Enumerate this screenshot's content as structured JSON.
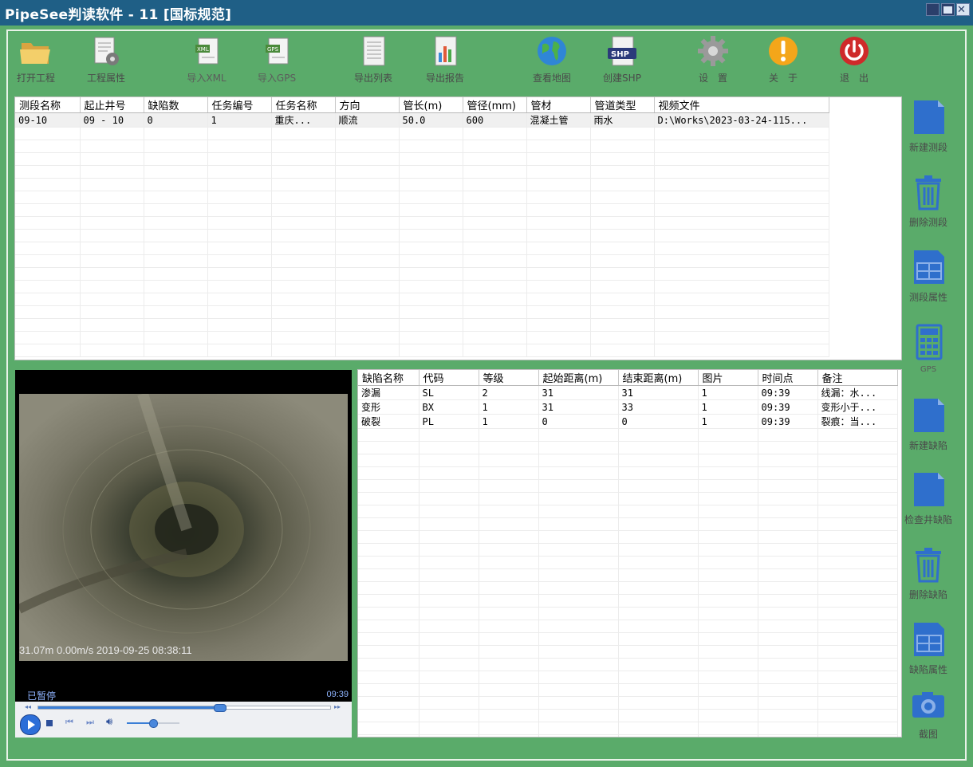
{
  "window": {
    "title": "PipeSee判读软件 - 11 [国标规范]"
  },
  "toolbar": [
    {
      "id": "open",
      "label": "打开工程",
      "icon": "folder-icon"
    },
    {
      "id": "props",
      "label": "工程属性",
      "icon": "project-settings-icon"
    },
    {
      "id": "xml",
      "label": "导入XML",
      "icon": "xml-file-icon"
    },
    {
      "id": "gps",
      "label": "导入GPS",
      "icon": "gps-file-icon"
    },
    {
      "id": "list",
      "label": "导出列表",
      "icon": "document-icon"
    },
    {
      "id": "report",
      "label": "导出报告",
      "icon": "report-chart-icon"
    },
    {
      "id": "map",
      "label": "查看地图",
      "icon": "globe-icon"
    },
    {
      "id": "shp",
      "label": "创建SHP",
      "icon": "shp-file-icon"
    },
    {
      "id": "settings",
      "label": "设　置",
      "icon": "gear-icon"
    },
    {
      "id": "about",
      "label": "关　于",
      "icon": "info-exclamation-icon"
    },
    {
      "id": "exit",
      "label": "退　出",
      "icon": "power-icon"
    }
  ],
  "segments_table": {
    "columns": [
      "测段名称",
      "起止井号",
      "缺陷数",
      "任务编号",
      "任务名称",
      "方向",
      "管长(m)",
      "管径(mm)",
      "管材",
      "管道类型",
      "视频文件"
    ],
    "rows": [
      [
        "09-10",
        "09 - 10",
        "0",
        "1",
        "重庆...",
        "顺流",
        "50.0",
        "600",
        "混凝土管",
        "雨水",
        "D:\\Works\\2023-03-24-115..."
      ]
    ]
  },
  "defects_table": {
    "columns": [
      "缺陷名称",
      "代码",
      "等级",
      "起始距离(m)",
      "结束距离(m)",
      "图片",
      "时间点",
      "备注"
    ],
    "rows": [
      [
        "渗漏",
        "SL",
        "2",
        "31",
        "31",
        "1",
        "09:39",
        "线漏：水..."
      ],
      [
        "变形",
        "BX",
        "1",
        "31",
        "33",
        "1",
        "09:39",
        "变形小于..."
      ],
      [
        "破裂",
        "PL",
        "1",
        "0",
        "0",
        "1",
        "09:39",
        "裂痕：当..."
      ]
    ]
  },
  "sidebar": [
    {
      "id": "new-segment",
      "label": "新建测段",
      "icon": "new-document-icon"
    },
    {
      "id": "delete-segment",
      "label": "删除测段",
      "icon": "trash-icon"
    },
    {
      "id": "segment-props",
      "label": "测段属性",
      "icon": "table-properties-icon"
    },
    {
      "id": "gps",
      "label": "GPS",
      "icon": "calculator-icon"
    },
    {
      "id": "new-defect",
      "label": "新建缺陷",
      "icon": "new-document-icon"
    },
    {
      "id": "check-well",
      "label": "检查井缺陷",
      "icon": "new-document-icon"
    },
    {
      "id": "delete-defect",
      "label": "删除缺陷",
      "icon": "trash-icon"
    },
    {
      "id": "defect-props",
      "label": "缺陷属性",
      "icon": "table-properties-icon"
    },
    {
      "id": "screenshot",
      "label": "截图",
      "icon": "camera-icon"
    }
  ],
  "video": {
    "overlay": "31.07m 0.00m/s  2019-09-25 08:38:11",
    "status": "已暂停",
    "time": "09:39",
    "progress": 0.62,
    "volume": 0.5
  },
  "colors": {
    "titlebar": "#1f5f86",
    "frame": "#5aab6a",
    "sidebar_icon": "#2f6fcc"
  }
}
